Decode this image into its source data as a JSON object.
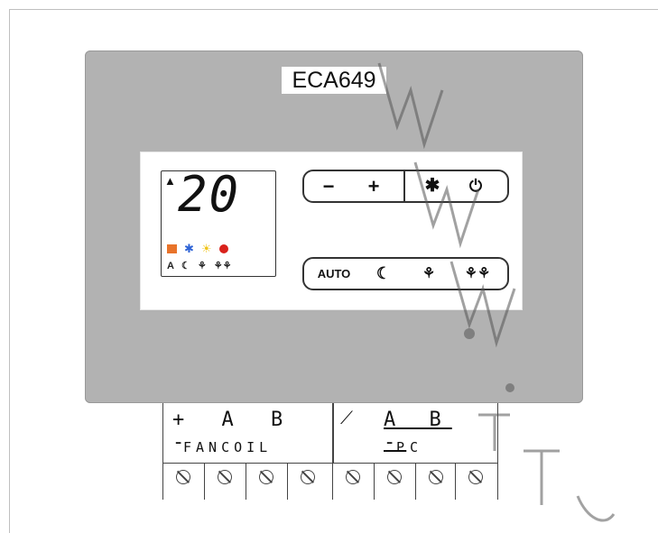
{
  "device": {
    "model": "ECA649",
    "lcd": {
      "indicator": "▲",
      "temperature": "20",
      "mode_icons": [
        "orange-square",
        "snowflake-icon",
        "sun-icon",
        "red-dot"
      ],
      "fan_icons": [
        "A",
        "moon-icon",
        "fan-1-icon",
        "fan-2-icon"
      ]
    },
    "top_buttons": {
      "minus": "−",
      "plus": "+",
      "cool": "✱",
      "power": "⏻"
    },
    "bottom_buttons": {
      "auto": "AUTO",
      "night": "☾",
      "fan_low": "⚘",
      "fan_high": "⚘⚘"
    }
  },
  "terminal": {
    "fancoil_top": "+ A B -",
    "fancoil_label": "FANCOIL",
    "pc_top": "A B -",
    "pc_label": "PC",
    "screws": 8
  },
  "watermark": "www."
}
